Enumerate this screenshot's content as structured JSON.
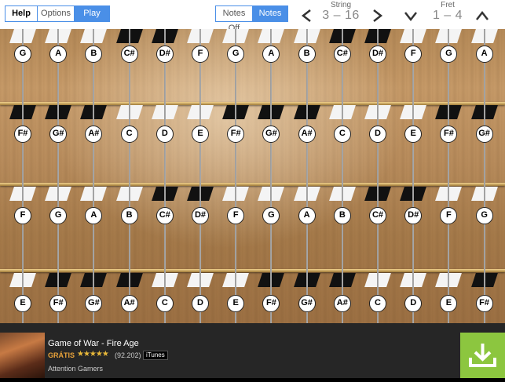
{
  "toolbar": {
    "help": "Help",
    "options": "Options",
    "play": "Play",
    "notes_off": "Notes Off",
    "notes_on": "Notes On"
  },
  "string_selector": {
    "label": "String",
    "value": "3 – 16"
  },
  "fret_selector": {
    "label": "Fret",
    "value": "1 – 4"
  },
  "fretboard": {
    "rows": [
      [
        "G",
        "A",
        "B",
        "C#",
        "D#",
        "F",
        "G",
        "A",
        "B",
        "C#",
        "D#",
        "F",
        "G",
        "A"
      ],
      [
        "F#",
        "G#",
        "A#",
        "C",
        "D",
        "E",
        "F#",
        "G#",
        "A#",
        "C",
        "D",
        "E",
        "F#",
        "G#"
      ],
      [
        "F",
        "G",
        "A",
        "B",
        "C#",
        "D#",
        "F",
        "G",
        "A",
        "B",
        "C#",
        "D#",
        "F",
        "G"
      ],
      [
        "E",
        "F#",
        "G#",
        "A#",
        "C",
        "D",
        "E",
        "F#",
        "G#",
        "A#",
        "C",
        "D",
        "E",
        "F#"
      ]
    ]
  },
  "ad": {
    "title": "Game of War - Fire Age",
    "price": "GRÁTIS",
    "stars": "★★★★★",
    "rating_count": "(92.202)",
    "store": "iTunes",
    "developer": "Attention Gamers"
  },
  "colors": {
    "accent": "#4a8fe7",
    "download": "#8cc63f",
    "price": "#e8a23a"
  }
}
